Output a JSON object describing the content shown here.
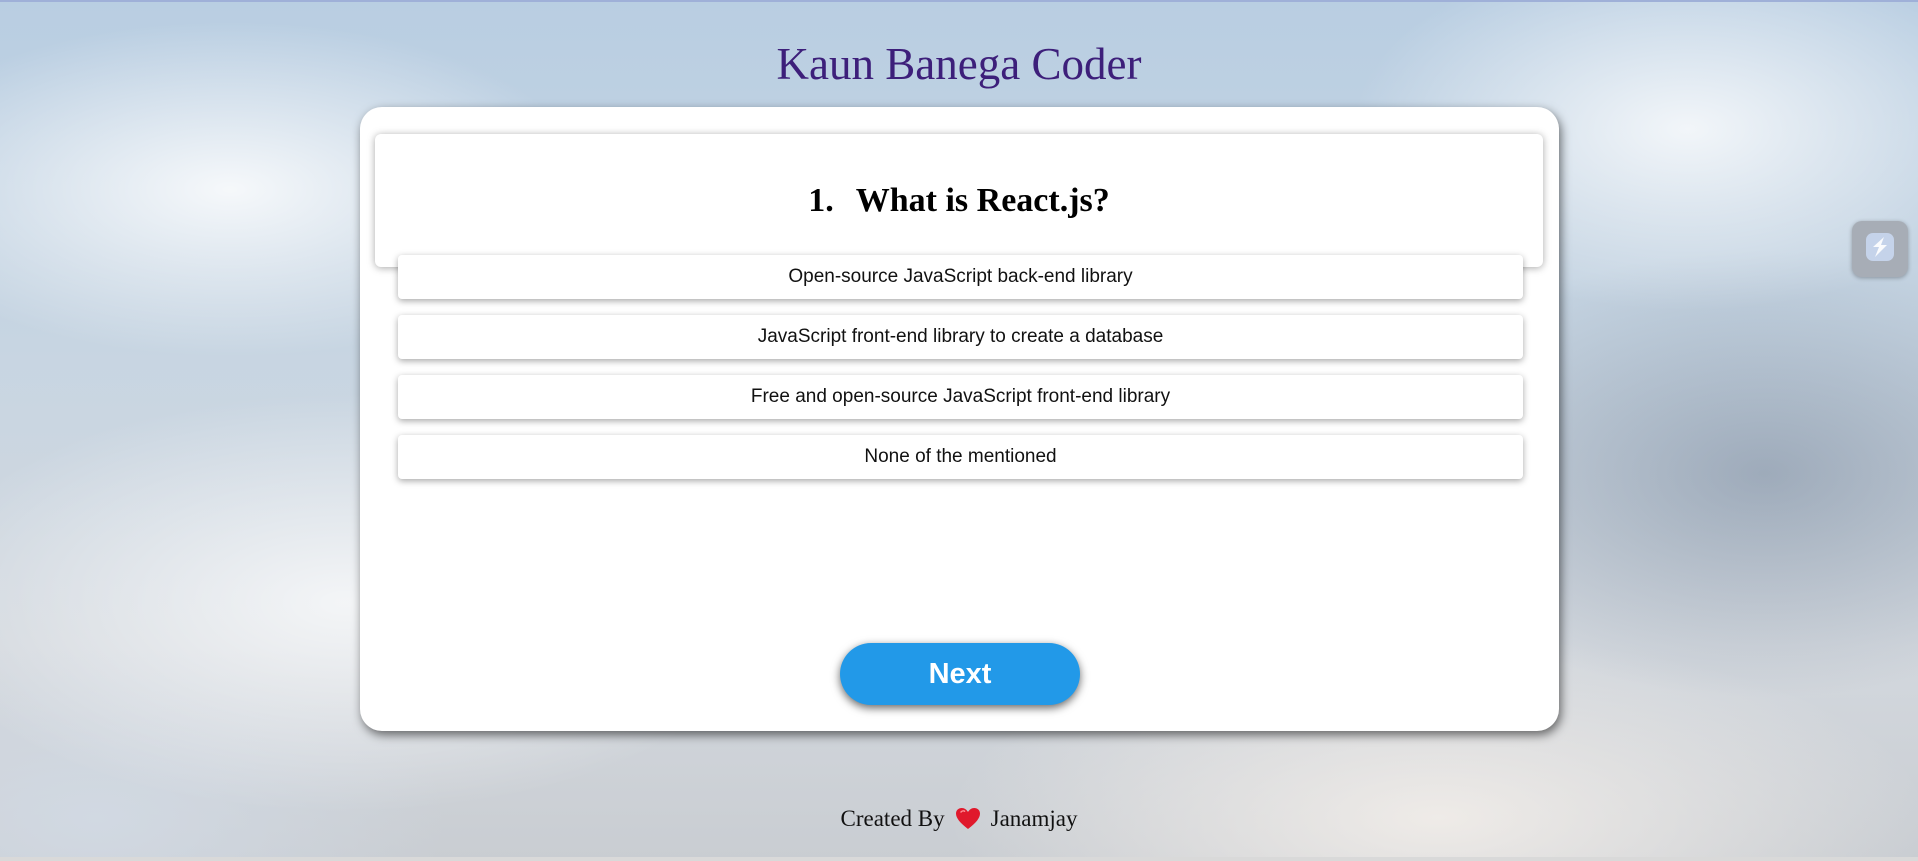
{
  "app": {
    "title": "Kaun Banega Coder"
  },
  "question": {
    "number": "1.",
    "text": "What is React.js?"
  },
  "options": [
    "Open-source JavaScript back-end library",
    "JavaScript front-end library to create a database",
    "Free and open-source JavaScript front-end library",
    "None of the mentioned"
  ],
  "actions": {
    "next_label": "Next"
  },
  "footer": {
    "prefix": "Created By",
    "icon": "heart-icon",
    "author": "Janamjay"
  },
  "side_widget": {
    "icon": "lightning-icon"
  },
  "colors": {
    "title": "#3d1f7a",
    "next_button": "#2299e8",
    "heart": "#e0192c"
  }
}
